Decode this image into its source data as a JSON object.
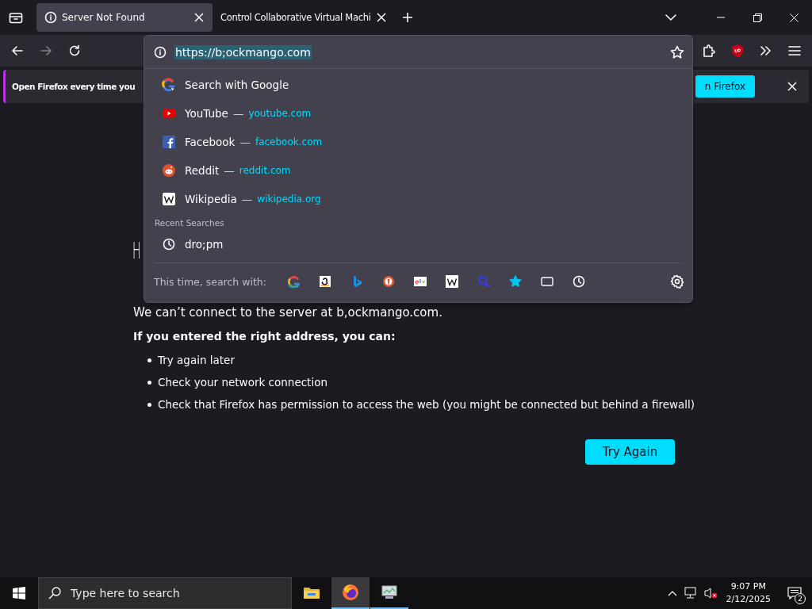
{
  "tabs": [
    {
      "title": "Server Not Found",
      "selected": true
    },
    {
      "title": "Control Collaborative Virtual Machi",
      "selected": false
    }
  ],
  "nav_buttons": [
    {
      "kind": "back",
      "disabled": false
    },
    {
      "kind": "forward",
      "disabled": true
    },
    {
      "kind": "reload",
      "disabled": false
    }
  ],
  "notification": {
    "message": "Open Firefox every time you",
    "button": "n Firefox"
  },
  "url_popup": {
    "url": "https://b;ockmango.com",
    "url_selected": true,
    "suggestions": [
      {
        "kind": "search",
        "title": "Search with Google"
      },
      {
        "kind": "youtube",
        "title": "YouTube",
        "dash": "—",
        "url": "youtube.com"
      },
      {
        "kind": "facebook",
        "title": "Facebook",
        "dash": "—",
        "url": "facebook.com"
      },
      {
        "kind": "reddit",
        "title": "Reddit",
        "dash": "—",
        "url": "reddit.com"
      },
      {
        "kind": "wikipedia",
        "title": "Wikipedia",
        "dash": "—",
        "url": "wikipedia.org"
      }
    ],
    "recent_heading": "Recent Searches",
    "recent": [
      {
        "text": "dro;pm"
      }
    ],
    "one_off_label": "This time, search with:",
    "engines": [
      {
        "kind": "google"
      },
      {
        "kind": "amazon"
      },
      {
        "kind": "bing"
      },
      {
        "kind": "duckduckgo"
      },
      {
        "kind": "ebay"
      },
      {
        "kind": "wikipedia"
      },
      {
        "kind": "search"
      },
      {
        "kind": "bookmarks"
      },
      {
        "kind": "tabs"
      },
      {
        "kind": "history"
      }
    ]
  },
  "error_page": {
    "heading": "H",
    "message": "We can’t connect to the server at b,ockmango.com.",
    "hint": "If you entered the right address, you can:",
    "bullets": [
      "Try again later",
      "Check your network connection",
      "Check that Firefox has permission to access the web (you might be connected but behind a firewall)"
    ],
    "button": "Try Again"
  },
  "taskbar": {
    "search_placeholder": "Type here to search",
    "apps": [
      {
        "kind": "explorer",
        "selected": false,
        "running": false
      },
      {
        "kind": "firefox",
        "selected": true,
        "running": true
      },
      {
        "kind": "vm",
        "selected": false,
        "running": true
      }
    ],
    "time": "9:07 PM",
    "date": "2/12/2025",
    "notifications": "2"
  }
}
